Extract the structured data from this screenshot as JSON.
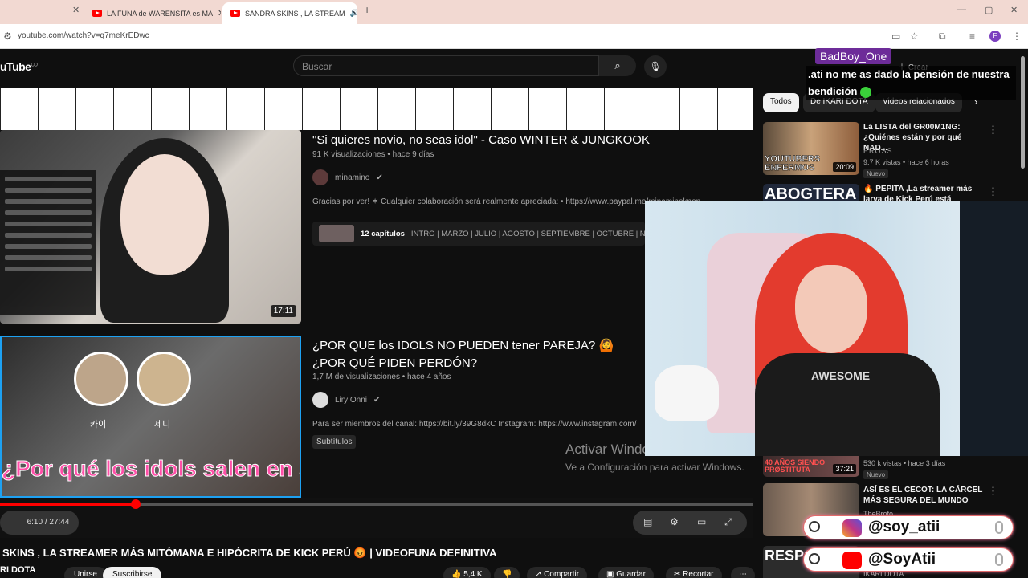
{
  "browser": {
    "tabs": [
      {
        "label": "LA FUNA de WARENSITA es MÁ",
        "close": "✕"
      },
      {
        "label": "SANDRA SKINS , LA STREAM",
        "close": "✕"
      }
    ],
    "new_tab": "+",
    "url": "youtube.com/watch?v=q7meKrEDwc",
    "profile_initial": "F",
    "window_controls": [
      "—",
      "▢",
      "✕"
    ]
  },
  "youtube": {
    "logo": "uTube",
    "logo_suffix": "CO",
    "search_placeholder": "Buscar",
    "create_label": "Crear"
  },
  "player": {
    "videos": [
      {
        "title": "\"Si quieres novio, no seas idol\" - Caso WINTER & JUNGKOOK",
        "meta": "91 K visualizaciones • hace 9 días",
        "channel": "minamino",
        "description": "Gracias por ver! ✶ Cualquier colaboración será realmente apreciada: • https://www.paypal.me/minaminokpop",
        "chapters_count": "12 capítulos",
        "chapters_list": "INTRO | MARZO | JULIO | AGOSTO | SEPTIEMBRE | OCTUBRE | N",
        "duration": "17:11",
        "thumb_notes": [
          "STOP USING JUNGKOOK , ATTENTION SEEKER",
          "PLASTIC FACE BITCH",
          "attention seeker, free jungkook pleaseee",
          "Have married life with JUNGKOOK??"
        ]
      },
      {
        "title": "¿POR QUE los IDOLS NO PUEDEN tener PAREJA? 🙆 ¿POR QUÉ PIDEN PERDÓN?",
        "meta": "1,7 M de visualizaciones • hace 4 años",
        "channel": "Liry Onni",
        "description": "Para ser miembros del canal: https://bit.ly/39G8dkC Instagram: https://www.instagram.com/",
        "badge": "Subtítulos",
        "thumb_caption": "¿Por qué los idols salen en secreto?",
        "thumb_names": [
          "카이",
          "제니"
        ]
      }
    ],
    "watermark_title": "Activar Windows",
    "watermark_sub": "Ve a Configuración para activar Windows.",
    "time": "6:10 / 27:44",
    "progress": 0.18
  },
  "video": {
    "title": "SKINS , LA STREAMER MÁS MITÓMANA E HIPÓCRITA DE KICK PERÚ 😡 | VIDEOFUNA DEFINITIVA",
    "channel": "RI DOTA",
    "join_label": "Unirse",
    "subscribe_label": "Suscribirse",
    "likes": "5,4 K",
    "share_label": "Compartir",
    "save_label": "Guardar",
    "clip_label": "Recortar"
  },
  "sidebar": {
    "chips": [
      "Todos",
      "De IKARI DOTA",
      "Videos relacionados"
    ],
    "items": [
      {
        "title": "La LISTA del GR00M1NG: ¿Quiénes están y por qué NAD...",
        "channel": "EROSS",
        "meta": "9.7 K vistas • hace 6 horas",
        "badge": "Nuevo",
        "duration": "20:09",
        "thumb_text": "YOUTUBERS ENFERMOS"
      },
      {
        "title": "🔥 PEPITA ,La streamer más larva de Kick Perú está",
        "thumb_text": "ABOGTERA"
      },
      {
        "title": "",
        "meta": "530 k vistas • hace 3 días",
        "badge": "Nuevo",
        "duration": "37:21",
        "thumb_text": "40 AÑOS SIENDO PRØSTITUTA"
      },
      {
        "title": "ASÍ ES EL CECOT: LA CÁRCEL MÁS SEGURA DEL MUNDO",
        "channel": "TheBrofo",
        "thumb_text": ""
      },
      {
        "title": "",
        "channel": "IKARI DOTA",
        "thumb_text": "RESPO"
      }
    ]
  },
  "chat": {
    "user": "BadBoy_One",
    "message": ".ati no me as dado la pensión de nuestra bendición"
  },
  "webcam": {
    "shirt_text": "AWESOME"
  },
  "socials": [
    {
      "handle": "@soy_atii",
      "network": "instagram",
      "color": "#c13584"
    },
    {
      "handle": "@SoyAtii",
      "network": "youtube",
      "color": "#ff0000"
    }
  ],
  "colors": {
    "accent": "#ff0000",
    "chat_user_bg": "#6d2c99"
  }
}
